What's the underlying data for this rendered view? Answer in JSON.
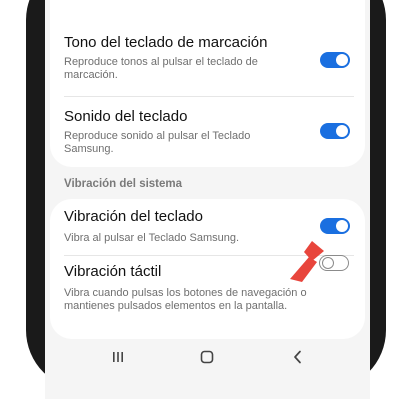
{
  "settings": {
    "items": [
      {
        "title": "Tono del teclado de marcación",
        "description": "Reproduce tonos al pulsar el teclado de marcación.",
        "enabled": true
      },
      {
        "title": "Sonido del teclado",
        "description": "Reproduce sonido al pulsar el Teclado Samsung.",
        "enabled": true
      }
    ],
    "section_header": "Vibración del sistema",
    "vibration_items": [
      {
        "title": "Vibración del teclado",
        "description": "Vibra al pulsar el Teclado Samsung.",
        "enabled": true
      },
      {
        "title": "Vibración táctil",
        "description": "Vibra cuando pulsas los botones de navegación o mantienes pulsados elementos en la pantalla.",
        "enabled": false
      }
    ]
  },
  "navbar": {
    "icons": [
      "recent-apps-icon",
      "home-icon",
      "back-icon"
    ]
  },
  "colors": {
    "toggle_on": "#1a6fe0",
    "arrow": "#e8453c",
    "background": "#f5f5f5"
  }
}
